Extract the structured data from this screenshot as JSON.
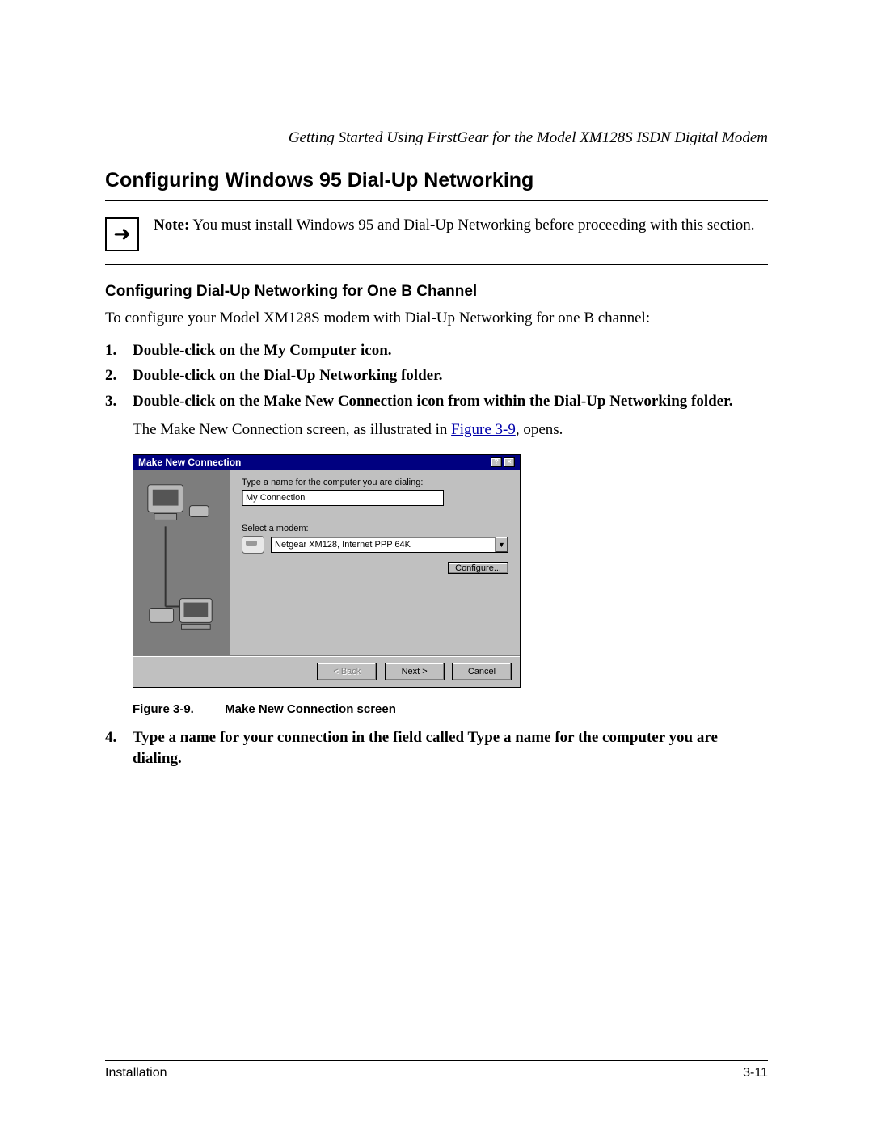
{
  "header": {
    "running_head": "Getting Started Using FirstGear for the Model XM128S ISDN Digital Modem"
  },
  "section": {
    "title": "Configuring Windows 95 Dial-Up Networking"
  },
  "note": {
    "label": "Note:",
    "text": " You must install Windows 95 and Dial-Up Networking before proceeding with this section."
  },
  "subsection": {
    "title": "Configuring Dial-Up Networking for One B Channel",
    "intro": "To configure your Model XM128S modem with Dial-Up Networking for one B channel:"
  },
  "steps": {
    "s1": "Double-click on the My Computer icon.",
    "s2": "Double-click on the Dial-Up Networking folder.",
    "s3": "Double-click on the Make New Connection icon from within the Dial-Up Networking folder.",
    "s3_follow_pre": "The Make New Connection screen, as illustrated in ",
    "s3_follow_link": "Figure 3-9",
    "s3_follow_post": ", opens.",
    "s4": "Type a name for your connection in the field called Type a name for the computer you are dialing."
  },
  "dialog": {
    "title": "Make New Connection",
    "label_name": "Type a name for the computer you are dialing:",
    "input_value": "My Connection",
    "label_modem": "Select a modem:",
    "select_value": "Netgear XM128, Internet PPP 64K",
    "btn_configure": "Configure...",
    "btn_back": "< Back",
    "btn_next": "Next >",
    "btn_cancel": "Cancel"
  },
  "figure": {
    "label": "Figure 3-9.",
    "caption": "Make New Connection screen"
  },
  "footer": {
    "section": "Installation",
    "page": "3-11"
  }
}
